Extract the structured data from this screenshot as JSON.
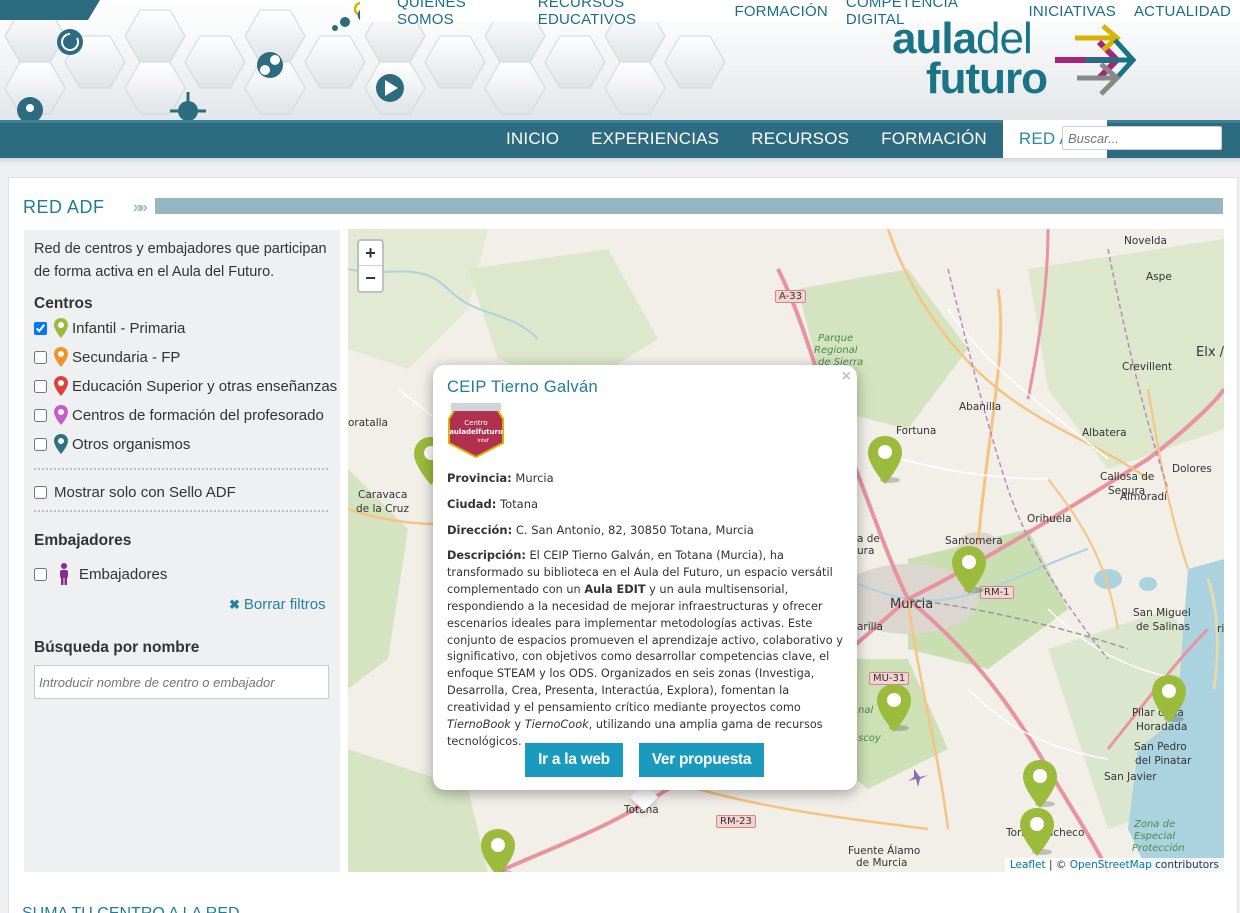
{
  "top_nav": {
    "links": [
      "QUIÉNES SOMOS",
      "RECURSOS EDUCATIVOS",
      "FORMACIÓN",
      "COMPETENCIA DIGITAL",
      "INICIATIVAS",
      "ACTUALIDAD"
    ]
  },
  "logo": {
    "line1_bold": "aula",
    "line1_light": "del",
    "line2": "futuro"
  },
  "main_nav": {
    "items": [
      "INICIO",
      "EXPERIENCIAS",
      "RECURSOS",
      "FORMACIÓN",
      "RED AdF"
    ],
    "active": "RED AdF",
    "search_placeholder": "Buscar..."
  },
  "section": {
    "title": "RED ADF",
    "chevrons": "»»"
  },
  "sidebar": {
    "intro": "Red de centros y embajadores que participan de forma activa en el Aula del Futuro.",
    "centros_heading": "Centros",
    "centros": [
      {
        "label": "Infantil - Primaria",
        "checked": true,
        "color": "#9cbb3c"
      },
      {
        "label": "Secundaria - FP",
        "checked": false,
        "color": "#f0932b"
      },
      {
        "label": "Educación Superior y otras enseñanzas",
        "checked": false,
        "color": "#e0423a"
      },
      {
        "label": "Centros de formación del profesorado",
        "checked": false,
        "color": "#c95bc9"
      },
      {
        "label": "Otros organismos",
        "checked": false,
        "color": "#2c7282"
      }
    ],
    "sello_label": "Mostrar solo con Sello ADF",
    "embajadores_heading": "Embajadores",
    "embajadores_label": "Embajadores",
    "embajador_color": "#8a2c8f",
    "clear_label": "Borrar filtros",
    "search_heading": "Búsqueda por nombre",
    "search_placeholder": "Introducir nombre de centro o embajador"
  },
  "map": {
    "zoom_in": "+",
    "zoom_out": "−",
    "labels": {
      "novelda": "Novelda",
      "aspe": "Aspe",
      "elx": "Elx /",
      "crevillent": "Crevillent",
      "abanilla": "Abanilla",
      "albatera": "Albatera",
      "fortuna": "Fortuna",
      "callosa": "Callosa de",
      "segura": "Segura",
      "dolores": "Dolores",
      "almoradi": "Almoradí",
      "orihuela": "Orihuela",
      "santomera": "Santomera",
      "murcia": "Murcia",
      "san_miguel": "San Miguel",
      "de_salinas": "de Salinas",
      "pilar": "Pilar de la",
      "horadada": "Horadada",
      "san_pedro": "San Pedro",
      "del_pinatar": "del Pinatar",
      "san_javier": "San Javier",
      "torre": "Torre",
      "pacheco": "Pacheco",
      "totana": "Totana",
      "fuente_alamo": "Fuente Álamo",
      "de_murcia": "de Murcia",
      "caravaca": "Caravaca",
      "de_la_cruz": "de la Cruz",
      "oratalla": "oratalla",
      "parque": "Parque",
      "regional": "Regional",
      "de_sierra": "de Sierra",
      "zona_de": "Zona de",
      "especial": "Especial",
      "proteccion": "Protección",
      "nal": "nal",
      "scoy": "scoy",
      "a_de": "a de",
      "ura": "ura",
      "arilla": "arilla",
      "rilla": "rilla"
    },
    "roads": {
      "a33": "A-33",
      "rm1": "RM-1",
      "mu31": "MU-31",
      "rm23": "RM-23"
    },
    "attribution": {
      "leaflet": "Leaflet",
      "sep": " | © ",
      "osm": "OpenStreetMap",
      "contrib": " contributors"
    }
  },
  "popup": {
    "title": "CEIP Tierno Galván",
    "badge_line1": "Centro",
    "badge_line2": "auladelfuturo",
    "badge_line3": "intef",
    "provincia_label": "Provincia:",
    "provincia": "Murcia",
    "ciudad_label": "Ciudad:",
    "ciudad": "Totana",
    "direccion_label": "Dirección:",
    "direccion": "C. San Antonio, 82, 30850 Totana, Murcia",
    "descripcion_label": "Descripción:",
    "desc_1": "El CEIP Tierno Galván, en Totana (Murcia), ha transformado su biblioteca en el Aula del Futuro, un espacio versátil complementado con un",
    "desc_bold": "Aula EDIT",
    "desc_2": "y un aula multisensorial, respondiendo a la necesidad de mejorar infraestructuras y ofrecer escenarios ideales para implementar metodologías activas. Este conjunto de espacios promueven el aprendizaje activo, colaborativo y significativo, con objetivos como desarrollar competencias clave, el enfoque STEAM y los ODS. Organizados en seis zonas (Investiga, Desarrolla, Crea, Presenta, Interactúa, Explora), fomentan la creatividad y el pensamiento crítico mediante proyectos como",
    "desc_it1": "TiernoBook",
    "desc_and": "y",
    "desc_it2": "TiernoCook",
    "desc_3": ", utilizando una amplia gama de recursos tecnológicos.",
    "btn_web": "Ir a la web",
    "btn_propuesta": "Ver propuesta",
    "close": "×"
  },
  "bottom": {
    "title": "SUMA TU CENTRO A LA RED"
  }
}
